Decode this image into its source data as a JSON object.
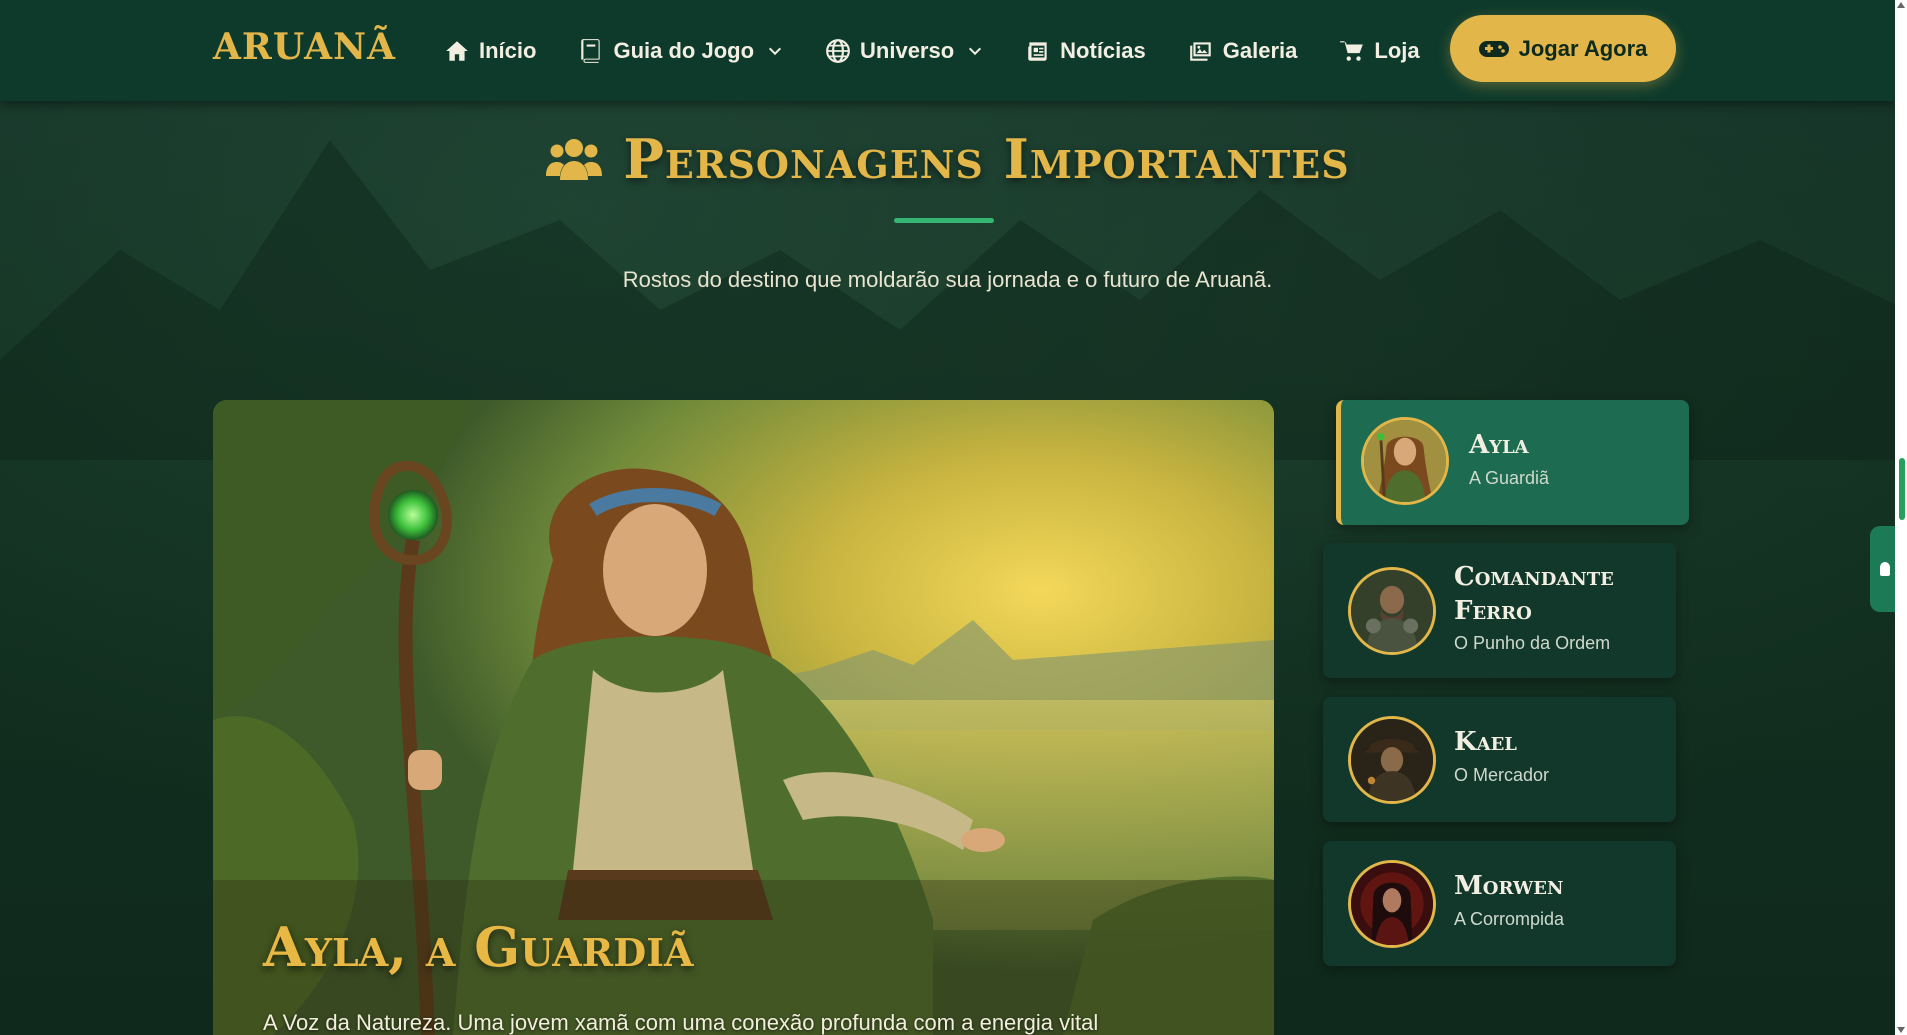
{
  "brand": {
    "logo": "ARUANÃ"
  },
  "nav": {
    "items": [
      {
        "label": "Início",
        "icon": "home-icon",
        "dropdown": false
      },
      {
        "label": "Guia do Jogo",
        "icon": "book-icon",
        "dropdown": true
      },
      {
        "label": "Universo",
        "icon": "globe-icon",
        "dropdown": true
      },
      {
        "label": "Notícias",
        "icon": "newspaper-icon",
        "dropdown": false
      },
      {
        "label": "Galeria",
        "icon": "images-icon",
        "dropdown": false
      },
      {
        "label": "Loja",
        "icon": "cart-icon",
        "dropdown": false
      }
    ],
    "cta": {
      "label": "Jogar Agora",
      "icon": "gamepad-icon"
    }
  },
  "section": {
    "icon": "users-icon",
    "title": "Personagens Importantes",
    "subtitle": "Rostos do destino que moldarão sua jornada e o futuro de Aruanã."
  },
  "featured": {
    "name": "Ayla, a Guardiã",
    "description": "A Voz da Natureza. Uma jovem xamã com uma conexão profunda com a energia vital"
  },
  "characters": [
    {
      "name": "Ayla",
      "role": "A Guardiã",
      "active": true
    },
    {
      "name": "Comandante Ferro",
      "role": "O Punho da Ordem",
      "active": false
    },
    {
      "name": "Kael",
      "role": "O Mercador",
      "active": false
    },
    {
      "name": "Morwen",
      "role": "A Corrompida",
      "active": false
    }
  ],
  "colors": {
    "accent_gold": "#e2b648",
    "nav_bg": "#0e3a2c",
    "active_card": "#1d6b50",
    "card_bg": "#12382c",
    "rule_green": "#36b673"
  }
}
